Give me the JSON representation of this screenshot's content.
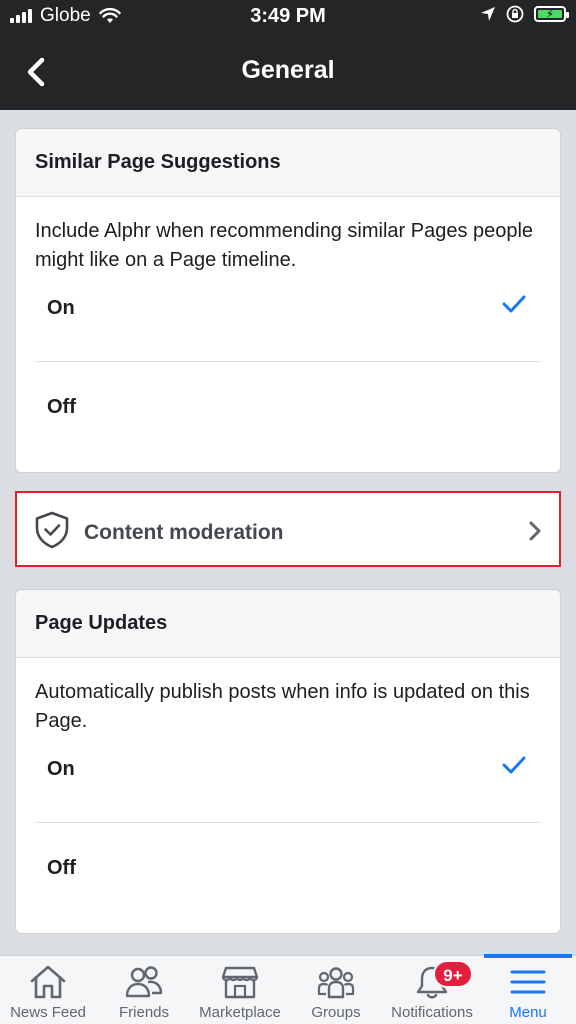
{
  "status_bar": {
    "carrier": "Globe",
    "time": "3:49 PM"
  },
  "nav": {
    "title": "General"
  },
  "similar_page_suggestions": {
    "title": "Similar Page Suggestions",
    "description": "Include Alphr when recommending similar Pages people might like on a Page timeline.",
    "options": [
      {
        "label": "On",
        "selected": true
      },
      {
        "label": "Off",
        "selected": false
      }
    ]
  },
  "content_moderation": {
    "label": "Content moderation"
  },
  "page_updates": {
    "title": "Page Updates",
    "description": "Automatically publish posts when info is updated on this Page.",
    "options": [
      {
        "label": "On",
        "selected": true
      },
      {
        "label": "Off",
        "selected": false
      }
    ]
  },
  "tabbar": {
    "items": [
      {
        "label": "News Feed",
        "icon": "home-icon"
      },
      {
        "label": "Friends",
        "icon": "friends-icon"
      },
      {
        "label": "Marketplace",
        "icon": "marketplace-icon"
      },
      {
        "label": "Groups",
        "icon": "groups-icon"
      },
      {
        "label": "Notifications",
        "icon": "bell-icon",
        "badge": "9+"
      },
      {
        "label": "Menu",
        "icon": "menu-icon",
        "active": true
      }
    ]
  },
  "colors": {
    "accent": "#1877f2",
    "highlight_border": "#e41e2a",
    "badge": "#e41e3f",
    "header_bg": "#242526"
  }
}
